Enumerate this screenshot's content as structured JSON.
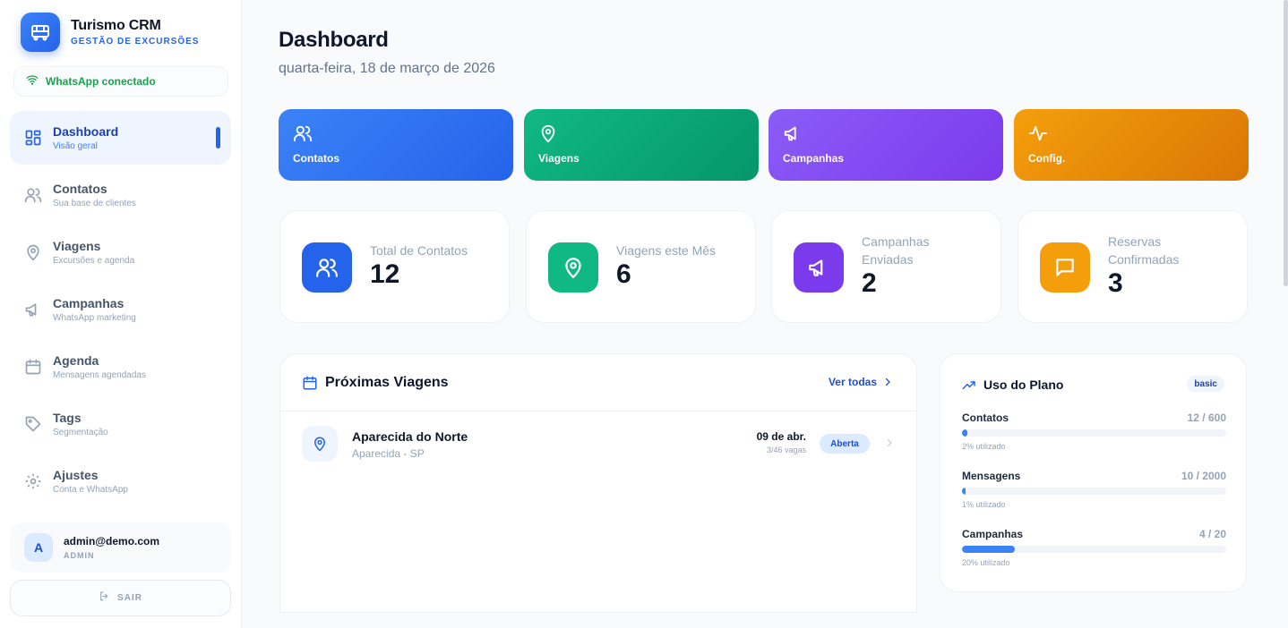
{
  "brand": {
    "title": "Turismo CRM",
    "subtitle": "GESTÃO DE EXCURSÕES",
    "logo_icon": "bus-icon"
  },
  "whatsapp_status": {
    "label": "WhatsApp conectado",
    "icon": "wifi-icon",
    "color": "#16a34a"
  },
  "sidebar": {
    "items": [
      {
        "label": "Dashboard",
        "sub": "Visão geral",
        "icon": "dashboard-icon",
        "active": true
      },
      {
        "label": "Contatos",
        "sub": "Sua base de clientes",
        "icon": "users-icon"
      },
      {
        "label": "Viagens",
        "sub": "Excursões e agenda",
        "icon": "map-pin-icon"
      },
      {
        "label": "Campanhas",
        "sub": "WhatsApp marketing",
        "icon": "megaphone-icon"
      },
      {
        "label": "Agenda",
        "sub": "Mensagens agendadas",
        "icon": "calendar-icon"
      },
      {
        "label": "Tags",
        "sub": "Segmentação",
        "icon": "tag-icon"
      },
      {
        "label": "Ajustes",
        "sub": "Conta e WhatsApp",
        "icon": "gear-icon"
      }
    ]
  },
  "user": {
    "initial": "A",
    "email": "admin@demo.com",
    "role": "ADMIN"
  },
  "logout": {
    "label": "SAIR",
    "icon": "logout-icon"
  },
  "header": {
    "title": "Dashboard",
    "date": "quarta-feira, 18 de março de 2026"
  },
  "quick_actions": [
    {
      "label": "Contatos",
      "icon": "users-icon",
      "color": "#2563eb"
    },
    {
      "label": "Viagens",
      "icon": "map-pin-icon",
      "color": "#059669"
    },
    {
      "label": "Campanhas",
      "icon": "megaphone-icon",
      "color": "#7c3aed"
    },
    {
      "label": "Config.",
      "icon": "activity-icon",
      "color": "#d97706"
    }
  ],
  "stats": [
    {
      "label": "Total de Contatos",
      "value": "12",
      "icon": "users-icon",
      "color": "#2563eb"
    },
    {
      "label": "Viagens este Mês",
      "value": "6",
      "icon": "map-pin-icon",
      "color": "#10b981"
    },
    {
      "label": "Campanhas Enviadas",
      "value": "2",
      "icon": "megaphone-icon",
      "color": "#7c3aed"
    },
    {
      "label": "Reservas Confirmadas",
      "value": "3",
      "icon": "message-icon",
      "color": "#f59e0b"
    }
  ],
  "trips": {
    "title": "Próximas Viagens",
    "link": "Ver todas",
    "rows": [
      {
        "name": "Aparecida do Norte",
        "place": "Aparecida - SP",
        "date": "09 de abr.",
        "seats": "3/46 vagas",
        "status": "Aberta"
      }
    ]
  },
  "plan": {
    "title": "Uso do Plano",
    "badge": "basic",
    "usage": [
      {
        "name": "Contatos",
        "count": "12 / 600",
        "pct_label": "2% utilizado",
        "fraction": 0.02
      },
      {
        "name": "Mensagens",
        "count": "10 / 2000",
        "pct_label": "1% utilizado",
        "fraction": 0.01
      },
      {
        "name": "Campanhas",
        "count": "4 / 20",
        "pct_label": "20% utilizado",
        "fraction": 0.2
      }
    ]
  }
}
